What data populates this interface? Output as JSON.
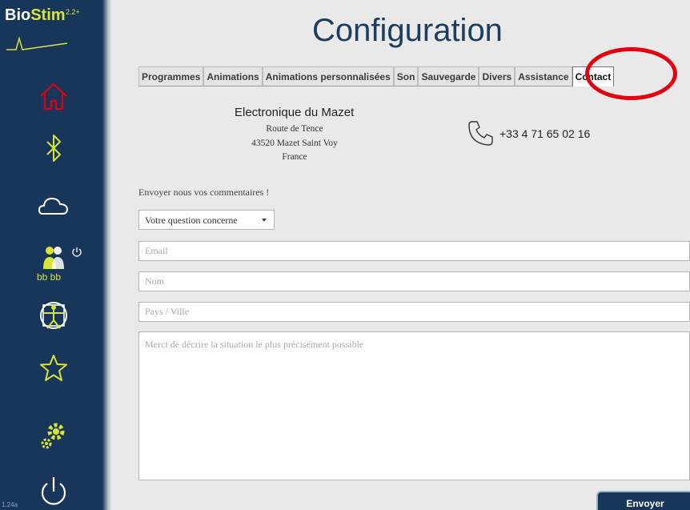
{
  "app": {
    "logo_prefix": "Bio",
    "logo_suffix": "Stim",
    "logo_version": "2.2+",
    "build": "1.24a",
    "accent_color": "#d6e43a",
    "sidebar_color": "#17365a"
  },
  "sidebar": {
    "icons": [
      "home-icon",
      "bluetooth-icon",
      "cloud-icon",
      "user-group-icon",
      "vitruvian-man-icon",
      "star-icon",
      "gears-icon",
      "power-icon"
    ],
    "user_label": "bb bb"
  },
  "page": {
    "title": "Configuration"
  },
  "tabs": [
    {
      "label": "Programmes",
      "active": false
    },
    {
      "label": "Animations",
      "active": false
    },
    {
      "label": "Animations personnalisées",
      "active": false
    },
    {
      "label": "Son",
      "active": false
    },
    {
      "label": "Sauvegarde",
      "active": false
    },
    {
      "label": "Divers",
      "active": false
    },
    {
      "label": "Assistance",
      "active": false
    },
    {
      "label": "Contact",
      "active": true
    }
  ],
  "contact": {
    "company": "Electronique du Mazet",
    "street": "Route de Tence",
    "city": "43520 Mazet Saint Voy",
    "country": "France",
    "phone": "+33 4 71 65 02 16"
  },
  "form": {
    "intro": "Envoyer nous vos commentaires !",
    "subject_value": "Votre question concerne",
    "email_placeholder": "Email",
    "name_placeholder": "Nom",
    "country_placeholder": "Pays / Ville",
    "message_placeholder": "Merci de décrire la situation le plus précisément possible",
    "send_label": "Envoyer"
  }
}
